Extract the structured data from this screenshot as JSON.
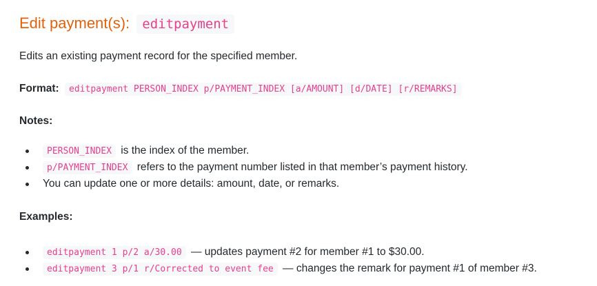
{
  "title": {
    "text": "Edit payment(s):",
    "command": "editpayment"
  },
  "description": "Edits an existing payment record for the specified member.",
  "format": {
    "label": "Format:",
    "syntax": "editpayment PERSON_INDEX p/PAYMENT_INDEX [a/AMOUNT] [d/DATE] [r/REMARKS]"
  },
  "notes": {
    "heading": "Notes:",
    "items": [
      {
        "code": "PERSON_INDEX",
        "text": "is the index of the member."
      },
      {
        "code": "p/PAYMENT_INDEX",
        "text": "refers to the payment number listed in that member’s payment history."
      },
      {
        "code": "",
        "text": "You can update one or more details: amount, date, or remarks."
      }
    ]
  },
  "examples": {
    "heading": "Examples:",
    "items": [
      {
        "code": "editpayment 1 p/2 a/30.00",
        "text": "— updates payment #2 for member #1 to $30.00."
      },
      {
        "code": "editpayment 3 p/1 r/Corrected to event fee",
        "text": "— changes the remark for payment #1 of member #3."
      }
    ]
  }
}
